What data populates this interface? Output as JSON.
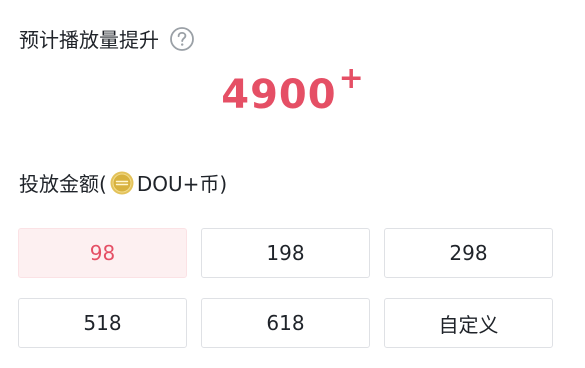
{
  "estimate": {
    "label": "预计播放量提升",
    "value": "4900",
    "suffix": "+"
  },
  "amount": {
    "label_prefix": "投放金额(",
    "currency_text": "DOU+币)",
    "coin_icon": "dou-coin-icon"
  },
  "options": [
    {
      "label": "98",
      "selected": true
    },
    {
      "label": "198",
      "selected": false
    },
    {
      "label": "298",
      "selected": false
    },
    {
      "label": "518",
      "selected": false
    },
    {
      "label": "618",
      "selected": false
    },
    {
      "label": "自定义",
      "selected": false
    }
  ],
  "colors": {
    "accent": "#e54f65",
    "selected_bg": "#fdf0f1",
    "border": "#dfe1e5",
    "coin": "#d8b23e"
  }
}
